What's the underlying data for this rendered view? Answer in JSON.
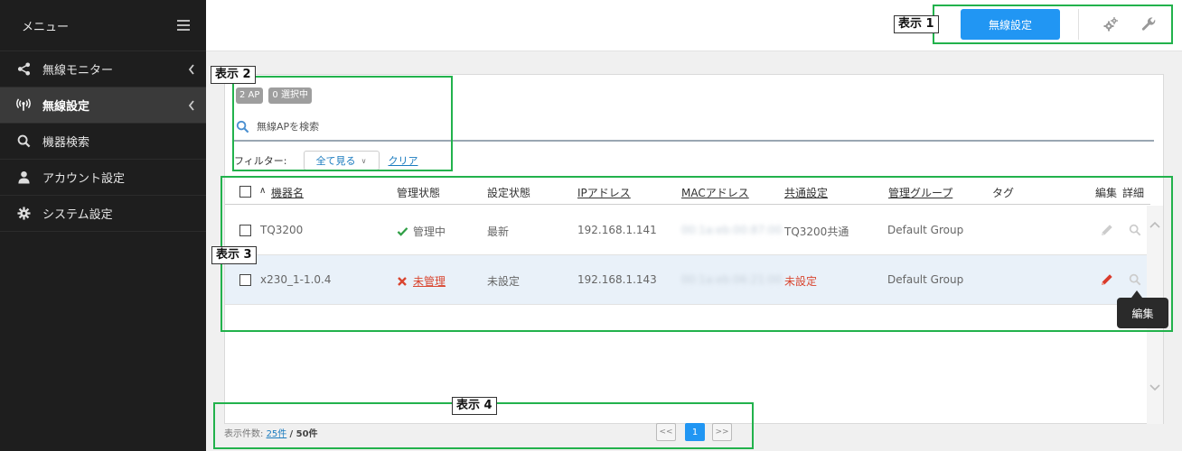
{
  "sidebar": {
    "title": "メニュー",
    "items": [
      {
        "label": "無線モニター",
        "icon": "share-icon"
      },
      {
        "label": "無線設定",
        "icon": "wireless-icon",
        "active": true
      },
      {
        "label": "機器検索",
        "icon": "search-icon"
      },
      {
        "label": "アカウント設定",
        "icon": "user-icon"
      },
      {
        "label": "システム設定",
        "icon": "gear-icon"
      }
    ]
  },
  "toolbar": {
    "primary_label": "無線設定",
    "icons": [
      "gears-icon",
      "wrench-icon"
    ]
  },
  "callouts": [
    "表示 1",
    "表示 2",
    "表示 3",
    "表示 4"
  ],
  "panel": {
    "badge_ap": "2 AP",
    "badge_selected": "0 選択中",
    "search_placeholder": "無線APを検索",
    "filter_label": "フィルター:",
    "filter_value": "全て見る",
    "clear_label": "クリア"
  },
  "table": {
    "headers": {
      "sort_indicator": "∧",
      "device_name": "機器名",
      "manage_status": "管理状態",
      "config_status": "設定状態",
      "ip": "IPアドレス",
      "mac": "MACアドレス",
      "common_config": "共通設定",
      "group": "管理グループ",
      "tag": "タグ",
      "edit": "編集",
      "detail": "詳細"
    },
    "rows": [
      {
        "name": "TQ3200",
        "status": "管理中",
        "config": "最新",
        "ip": "192.168.1.141",
        "mac": "00:1a:eb:00:87:00",
        "common": "TQ3200共通",
        "group": "Default Group"
      },
      {
        "name": "x230_1-1.0.4",
        "status": "未管理",
        "config": "未設定",
        "ip": "192.168.1.143",
        "mac": "00:1a:eb:06:21:00",
        "common": "未設定",
        "group": "Default Group"
      }
    ]
  },
  "tooltip": "編集",
  "footer": {
    "count_label": "表示件数:",
    "count_value": "25件",
    "total": "/ 50件"
  },
  "pager": {
    "prev": "<<",
    "current": "1",
    "next": ">>"
  },
  "colors": {
    "primary": "#2196f3",
    "callout_border": "#22b24c",
    "ok": "#2e9e44",
    "error": "#d9452f",
    "sidebar_bg": "#1e1e1e"
  }
}
